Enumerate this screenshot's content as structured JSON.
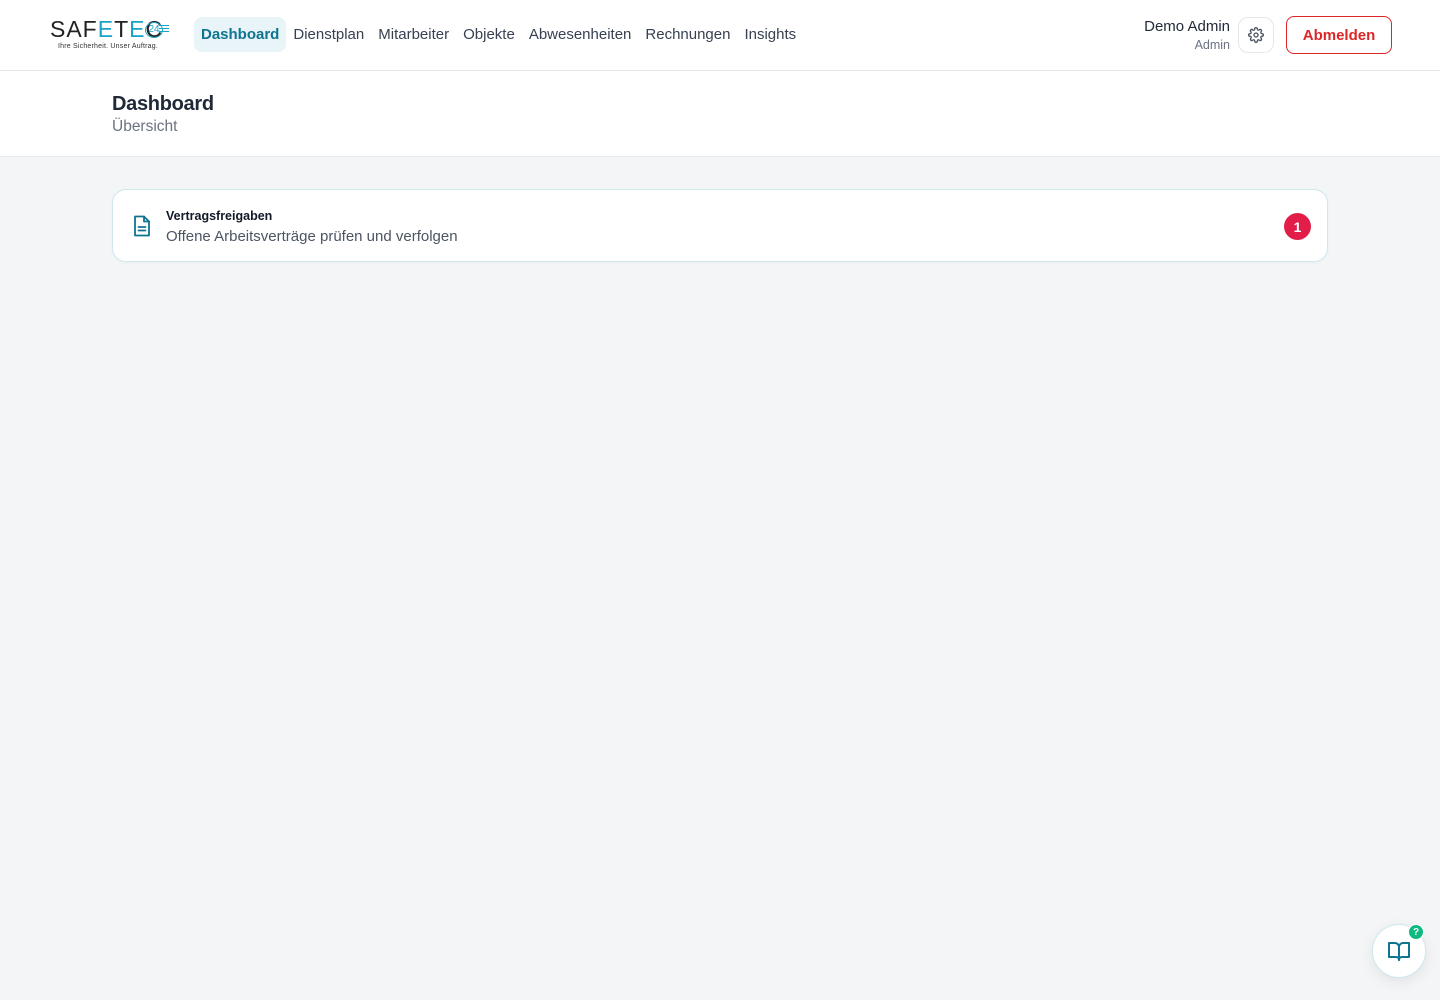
{
  "brand": {
    "word_left": "SAF",
    "word_e": "E",
    "word_t": "T",
    "word_e2": "E",
    "word_right": "C",
    "number": "24",
    "tagline": "Ihre Sicherheit. Unser Auftrag."
  },
  "nav": {
    "items": [
      {
        "label": "Dashboard",
        "active": true
      },
      {
        "label": "Dienstplan",
        "active": false
      },
      {
        "label": "Mitarbeiter",
        "active": false
      },
      {
        "label": "Objekte",
        "active": false
      },
      {
        "label": "Abwesenheiten",
        "active": false
      },
      {
        "label": "Rechnungen",
        "active": false
      },
      {
        "label": "Insights",
        "active": false
      }
    ]
  },
  "user": {
    "name": "Demo Admin",
    "role": "Admin",
    "settings_icon": "gear-icon",
    "logout_label": "Abmelden"
  },
  "page": {
    "title": "Dashboard",
    "subtitle": "Übersicht"
  },
  "cards": [
    {
      "title": "Vertragsfreigaben",
      "description": "Offene Arbeitsverträge prüfen und verfolgen",
      "badge": "1",
      "icon": "document-icon"
    }
  ],
  "help": {
    "icon": "book-icon",
    "badge": "?"
  },
  "colors": {
    "accent": "#0e7490",
    "danger": "#dc2626",
    "badge": "#e11d48",
    "help_badge": "#10b981"
  }
}
